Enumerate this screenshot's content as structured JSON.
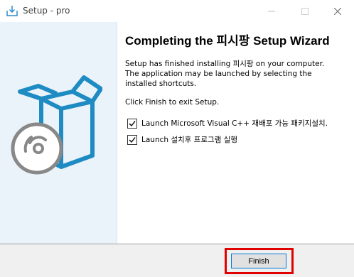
{
  "window": {
    "title": "Setup - pro",
    "icon": "setup-installer-icon"
  },
  "header": {
    "title": "Completing the 피시팡 Setup Wizard"
  },
  "body": {
    "paragraph1": "Setup has finished installing 피시팡 on your computer. The application may be launched by selecting the installed shortcuts.",
    "paragraph2": "Click Finish to exit Setup."
  },
  "options": [
    {
      "label": "Launch Microsoft Visual C++ 재배포 가능 패키지설치.",
      "checked": true
    },
    {
      "label": "Launch 설치후 프로그램 실행",
      "checked": true
    }
  ],
  "buttons": {
    "finish": "Finish"
  },
  "colors": {
    "accent": "#1e8bc3",
    "side_panel": "#eaf3fa",
    "highlight": "#e00000",
    "button_border": "#0078d7"
  }
}
